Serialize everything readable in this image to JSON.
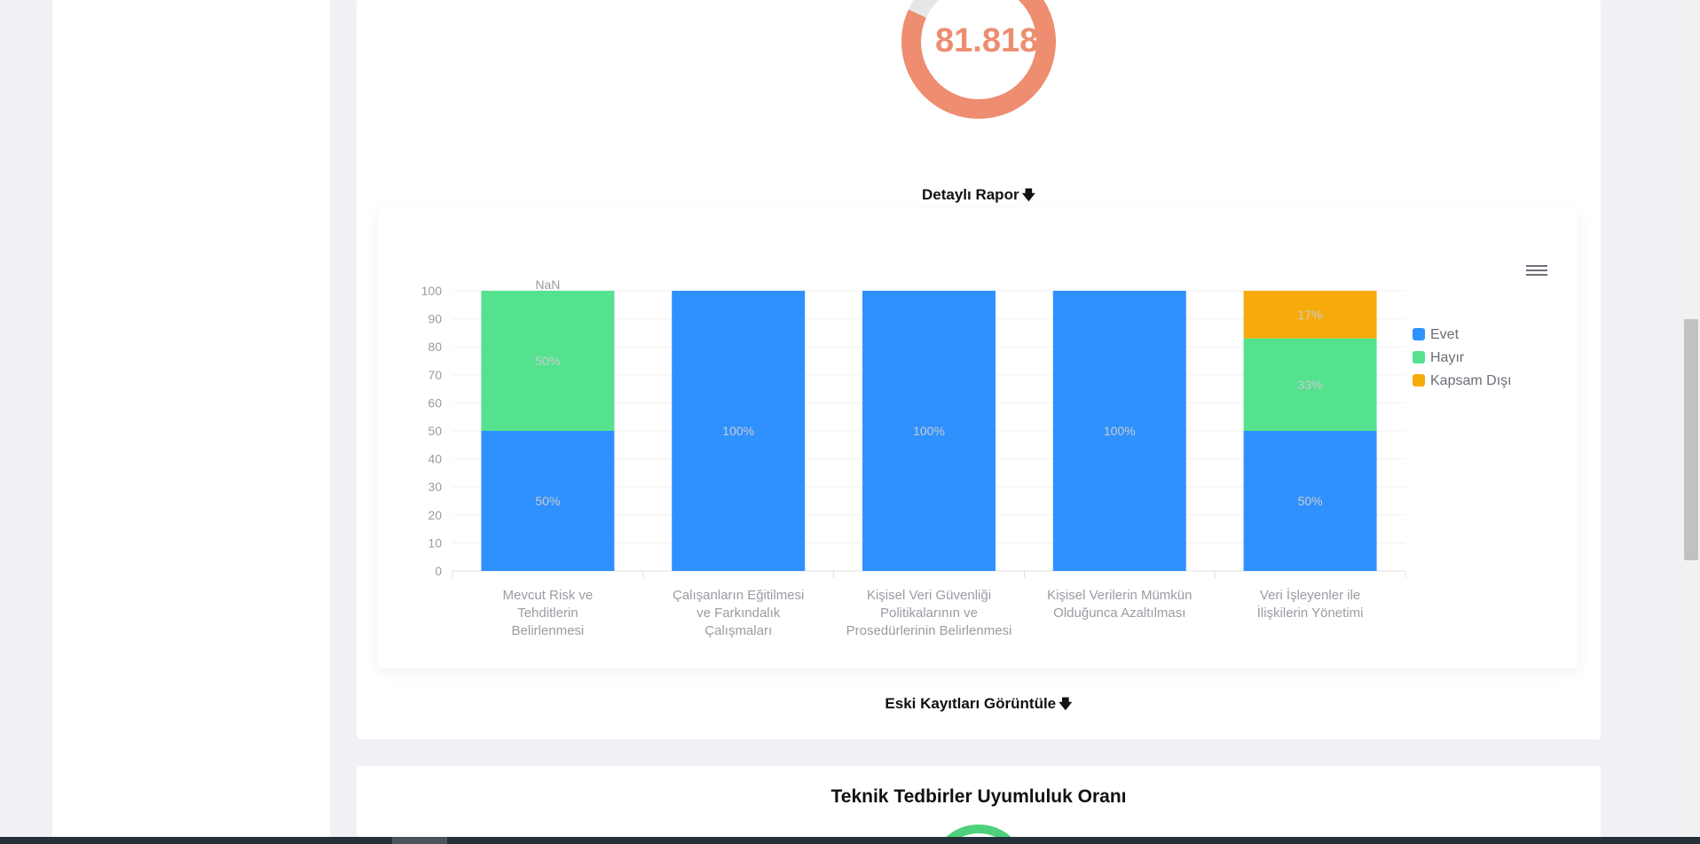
{
  "gauge": {
    "value_text": "81.818",
    "fraction": 0.818,
    "fill_color": "#ee8d6f",
    "track_color": "#e6e6e6"
  },
  "detail_link": {
    "label": "Detaylı Rapor",
    "icon": "arrow-down-icon"
  },
  "chart_data": {
    "type": "bar",
    "stacked": true,
    "categories": [
      [
        "Mevcut Risk ve",
        "Tehditlerin",
        "Belirlenmesi"
      ],
      [
        "Çalışanların Eğitilmesi",
        "ve Farkındalık",
        "Çalışmaları"
      ],
      [
        "Kişisel Veri Güvenliği",
        "Politikalarının ve",
        "Prosedürlerinin Belirlenmesi"
      ],
      [
        "Kişisel Verilerin Mümkün",
        "Olduğunca Azaltılması"
      ],
      [
        "Veri İşleyenler ile",
        "İlişkilerin Yönetimi"
      ]
    ],
    "series": [
      {
        "name": "Evet",
        "color": "#2f91fd",
        "values": [
          50,
          100,
          100,
          100,
          50
        ],
        "labels": [
          "50%",
          "100%",
          "100%",
          "100%",
          "50%"
        ]
      },
      {
        "name": "Hayır",
        "color": "#54e28e",
        "values": [
          50,
          0,
          0,
          0,
          33
        ],
        "labels": [
          "50%",
          "",
          "",
          "",
          "33%"
        ]
      },
      {
        "name": "Kapsam Dışı",
        "color": "#f7ab0a",
        "values": [
          0,
          0,
          0,
          0,
          17
        ],
        "labels": [
          "",
          "",
          "",
          "",
          "17%"
        ]
      }
    ],
    "top_labels": [
      "NaN",
      "",
      "",
      "",
      ""
    ],
    "ylim": [
      0,
      100
    ],
    "yticks": [
      0,
      10,
      20,
      30,
      40,
      50,
      60,
      70,
      80,
      90,
      100
    ],
    "legend_position": "right",
    "grid": true
  },
  "history_link": {
    "label": "Eski Kayıtları Görüntüle",
    "icon": "arrow-down-icon"
  },
  "second_card": {
    "title": "Teknik Tedbirler Uyumluluk Oranı"
  }
}
